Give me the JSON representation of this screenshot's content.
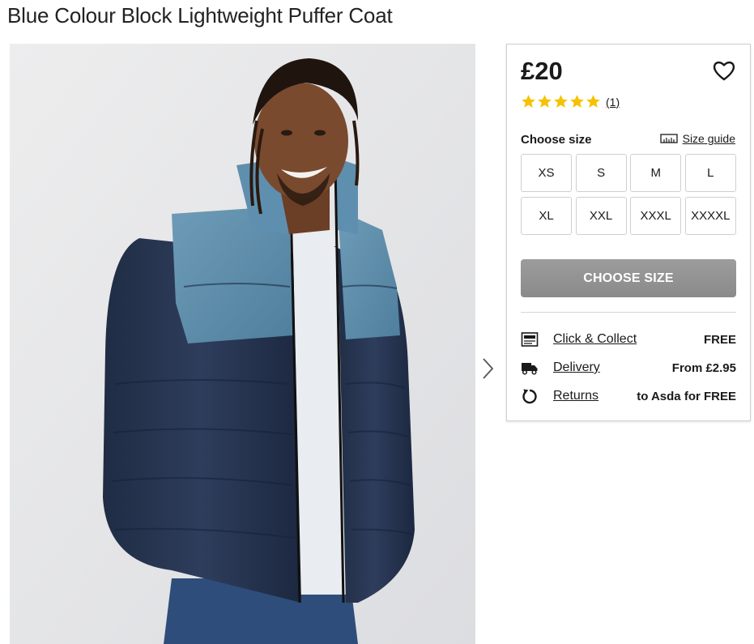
{
  "product": {
    "title": "Blue Colour Block Lightweight Puffer Coat",
    "price": "£20",
    "rating_count": "(1)",
    "rating_stars": 5
  },
  "size": {
    "label": "Choose size",
    "guide_label": "Size guide",
    "options": [
      "XS",
      "S",
      "M",
      "L",
      "XL",
      "XXL",
      "XXXL",
      "XXXXL"
    ],
    "cta_label": "CHOOSE SIZE"
  },
  "fulfilment": [
    {
      "icon": "click-collect-icon",
      "label": "Click & Collect",
      "value": "FREE"
    },
    {
      "icon": "delivery-truck-icon",
      "label": "Delivery",
      "value": "From £2.95"
    },
    {
      "icon": "returns-icon",
      "label": "Returns",
      "value": "to Asda for FREE"
    }
  ],
  "colors": {
    "star": "#f6c200",
    "cta_bg": "#929292",
    "border": "#cfcfcf"
  }
}
